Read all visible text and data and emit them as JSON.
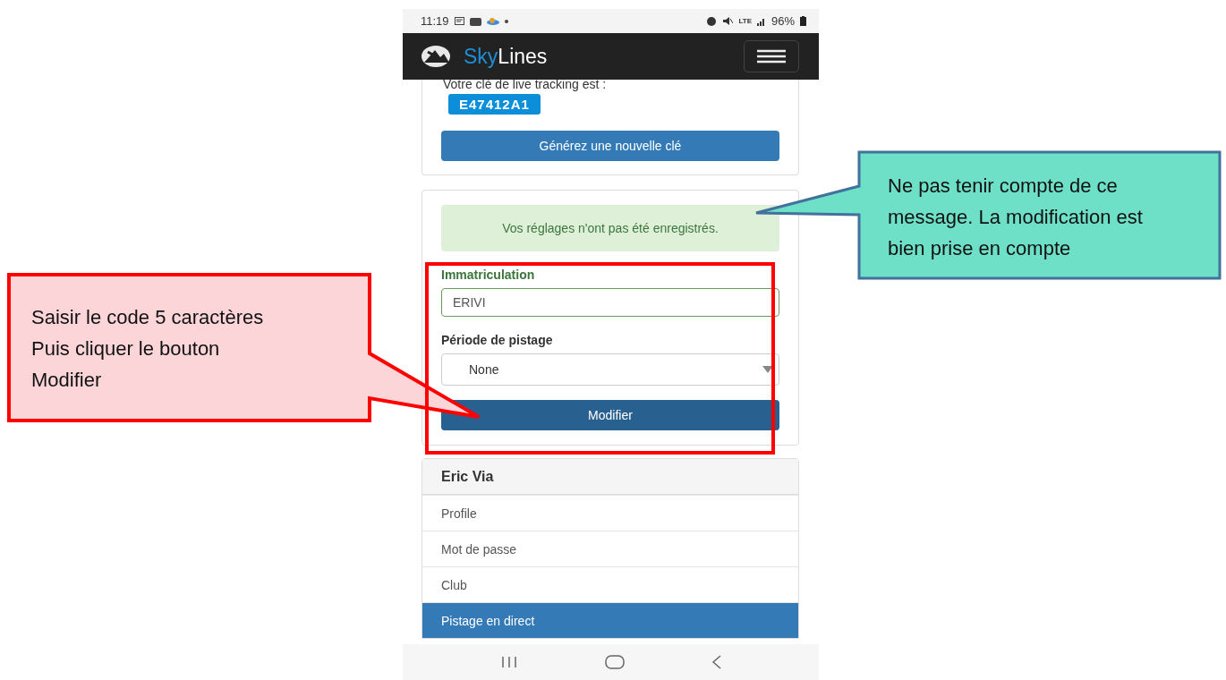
{
  "status_bar": {
    "time": "11:19",
    "network": "LTE",
    "battery": "96%"
  },
  "navbar": {
    "brand": [
      "Sky",
      "Lines"
    ]
  },
  "tracking_key": {
    "label": "Votre clé de live tracking est :",
    "key": "E47412A1",
    "button": "Générez une nouvelle clé"
  },
  "settings": {
    "alert": "Vos réglages n'ont pas été enregistrés.",
    "fields": [
      {
        "kind": "input",
        "label": "Immatriculation",
        "value": "ERIVI"
      },
      {
        "kind": "select",
        "label": "Période de pistage",
        "value": "None"
      }
    ],
    "button": "Modifier"
  },
  "account_menu": {
    "heading": "Eric Via",
    "items": [
      {
        "label": "Profile",
        "selected": false
      },
      {
        "label": "Mot de passe",
        "selected": false
      },
      {
        "label": "Club",
        "selected": false
      },
      {
        "label": "Pistage en direct",
        "selected": true
      }
    ]
  },
  "annotations": [
    {
      "kind": "instruction",
      "lines": [
        "Saisir le code 5 caractères",
        "Puis cliquer le bouton",
        "Modifier"
      ]
    },
    {
      "kind": "note",
      "lines": [
        "Ne pas tenir compte de ce",
        "message. La modification est",
        "bien prise en compte"
      ]
    }
  ]
}
